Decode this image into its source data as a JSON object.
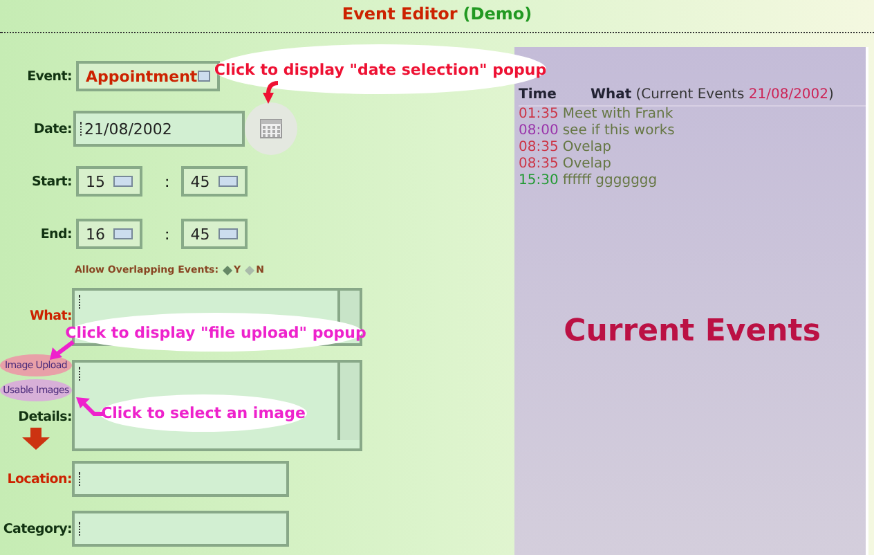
{
  "title": {
    "main": "Event Editor",
    "sub": "(Demo)"
  },
  "form": {
    "event": {
      "label": "Event:",
      "value": "Appointment"
    },
    "date": {
      "label": "Date:",
      "value": "21/08/2002"
    },
    "start": {
      "label": "Start:",
      "hour": "15",
      "separator": ":",
      "minute": "45"
    },
    "end": {
      "label": "End:",
      "hour": "16",
      "separator": ":",
      "minute": "45"
    },
    "overlap": {
      "label": "Allow Overlapping Events:",
      "options": [
        {
          "label": "Y",
          "selected": true
        },
        {
          "label": "N",
          "selected": false
        }
      ]
    },
    "what": {
      "label": "What:"
    },
    "image_upload": "Image Upload",
    "usable_images": "Usable Images",
    "details": {
      "label": "Details:"
    },
    "location": {
      "label": "Location:"
    },
    "category": {
      "label": "Category:"
    }
  },
  "callouts": [
    {
      "kind": "date",
      "text": "Click to display \"date selection\" popup"
    },
    {
      "kind": "upload",
      "text": "Click to display \"file upload\" popup"
    },
    {
      "kind": "select",
      "text": "Click to select an image"
    }
  ],
  "events_panel": {
    "time_header": "Time",
    "what_header": "What",
    "context_open": "(Current Events",
    "context_date": "21/08/2002",
    "context_close": ")",
    "events": [
      {
        "time": "01:35",
        "what": "Meet with Frank",
        "color": "#cc3344"
      },
      {
        "time": "08:00",
        "what": "see if this works",
        "color": "#9933aa"
      },
      {
        "time": "08:35",
        "what": "Ovelap",
        "color": "#cc3344"
      },
      {
        "time": "08:35",
        "what": "Ovelap",
        "color": "#cc3344"
      },
      {
        "time": "15:30",
        "what": "ffffff ggggggg",
        "color": "#229933"
      }
    ],
    "watermark": "Current Events"
  }
}
